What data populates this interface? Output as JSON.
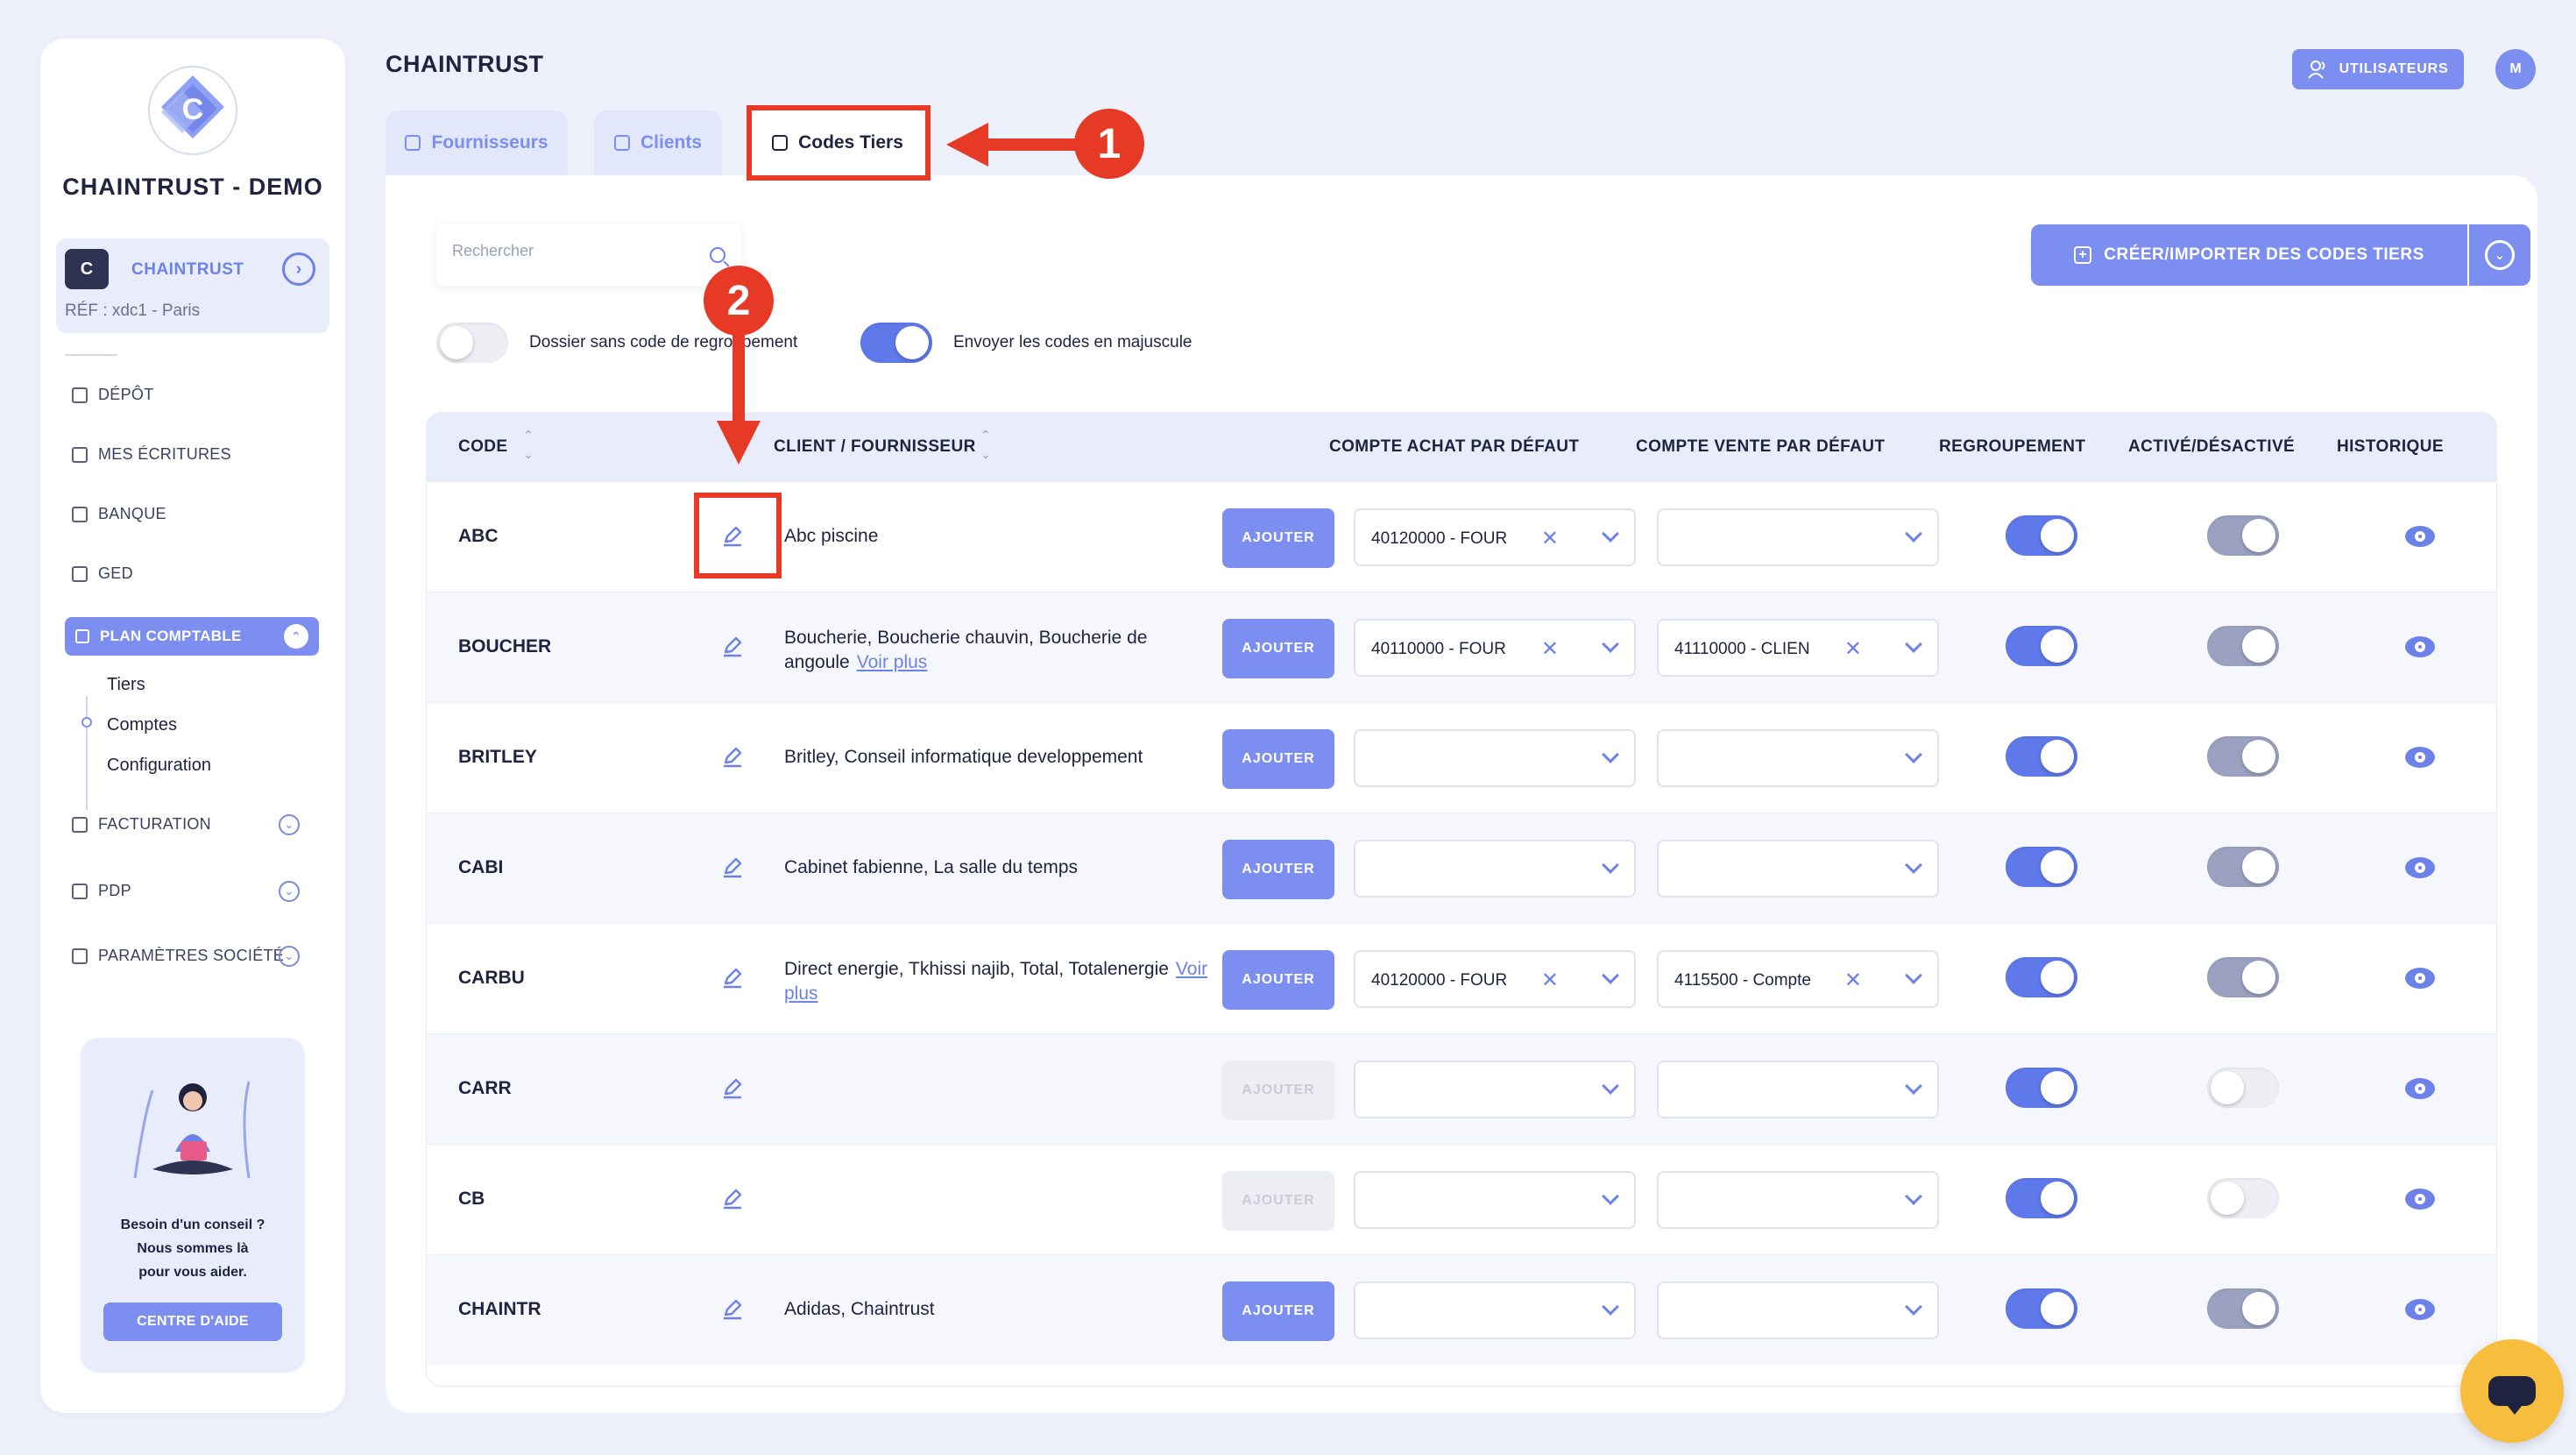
{
  "sidebar": {
    "brand": "CHAINTRUST - DEMO",
    "company": {
      "logo_letter": "C",
      "name": "CHAINTRUST",
      "ref": "RÉF : xdc1 - Paris"
    },
    "nav": [
      {
        "label": "DÉPÔT",
        "icon": "folder-icon"
      },
      {
        "label": "MES ÉCRITURES",
        "icon": "folder-icon"
      },
      {
        "label": "BANQUE",
        "icon": "bank-icon"
      },
      {
        "label": "GED",
        "icon": "document-icon"
      }
    ],
    "active": {
      "label": "PLAN COMPTABLE",
      "icon": "grid-icon"
    },
    "sub_items": [
      "Tiers",
      "Comptes",
      "Configuration"
    ],
    "nav_bottom": [
      {
        "label": "FACTURATION",
        "icon": "invoice-icon"
      },
      {
        "label": "PDP",
        "icon": "card-icon"
      },
      {
        "label": "PARAMÈTRES SOCIÉTÉ",
        "icon": "sliders-icon"
      }
    ],
    "help": {
      "text": "Besoin d'un conseil ?\nNous sommes là\npour vous aider.",
      "button": "CENTRE D'AIDE"
    }
  },
  "header": {
    "title": "CHAINTRUST",
    "users_button": "UTILISATEURS",
    "avatar": "M"
  },
  "tabs": [
    {
      "label": "Fournisseurs"
    },
    {
      "label": "Clients"
    },
    {
      "label": "Codes Tiers"
    }
  ],
  "toolbar": {
    "search_placeholder": "Rechercher",
    "toggle1_label": "Dossier sans code de regroupement",
    "toggle2_label": "Envoyer les codes en majuscule",
    "create_button": "CRÉER/IMPORTER DES CODES TIERS"
  },
  "table": {
    "headers": {
      "code": "CODE",
      "client": "CLIENT / FOURNISSEUR",
      "achat": "COMPTE ACHAT PAR DÉFAUT",
      "vente": "COMPTE VENTE PAR DÉFAUT",
      "regroupement": "REGROUPEMENT",
      "active": "ACTIVÉ/DÉSACTIVÉ",
      "historique": "HISTORIQUE"
    },
    "add_label": "AJOUTER",
    "more_label": "Voir plus",
    "rows": [
      {
        "code": "ABC",
        "client": "Abc piscine",
        "more": false,
        "achat": "40120000 - FOUR",
        "vente": "",
        "regroupement": true,
        "active": true,
        "add_enabled": true
      },
      {
        "code": "BOUCHER",
        "client": "Boucherie, Boucherie chauvin, Boucherie de angoule",
        "more": true,
        "achat": "40110000 - FOUR",
        "vente": "41110000 - CLIEN",
        "regroupement": true,
        "active": true,
        "add_enabled": true
      },
      {
        "code": "BRITLEY",
        "client": "Britley, Conseil informatique developpement",
        "more": false,
        "achat": "",
        "vente": "",
        "regroupement": true,
        "active": true,
        "add_enabled": true
      },
      {
        "code": "CABI",
        "client": "Cabinet fabienne, La salle du temps",
        "more": false,
        "achat": "",
        "vente": "",
        "regroupement": true,
        "active": true,
        "add_enabled": true
      },
      {
        "code": "CARBU",
        "client": "Direct energie, Tkhissi najib, Total, Totalenergie",
        "more": true,
        "achat": "40120000 - FOUR",
        "vente": "4115500 - Compte",
        "regroupement": true,
        "active": true,
        "add_enabled": true
      },
      {
        "code": "CARR",
        "client": "",
        "more": false,
        "achat": "",
        "vente": "",
        "regroupement": true,
        "active": false,
        "add_enabled": false
      },
      {
        "code": "CB",
        "client": "",
        "more": false,
        "achat": "",
        "vente": "",
        "regroupement": true,
        "active": false,
        "add_enabled": false
      },
      {
        "code": "CHAINTR",
        "client": "Adidas, Chaintrust",
        "more": false,
        "achat": "",
        "vente": "",
        "regroupement": true,
        "active": true,
        "add_enabled": true
      }
    ]
  },
  "annotations": {
    "one": "1",
    "two": "2"
  },
  "colors": {
    "accent": "#7c8ff0",
    "annotation": "#e63a27",
    "chat": "#f7bd3c"
  }
}
